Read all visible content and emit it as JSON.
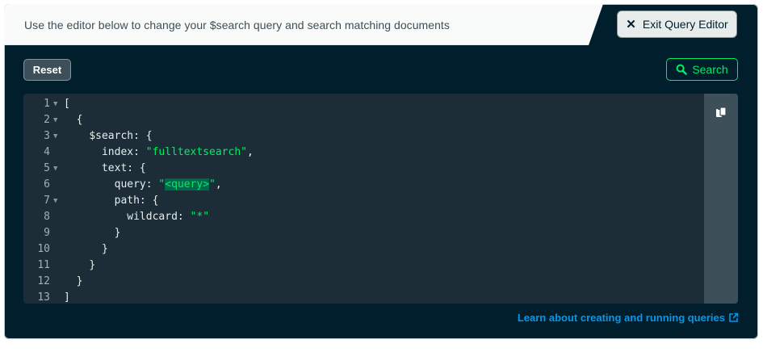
{
  "header": {
    "description": "Use the editor below to change your $search query and search matching documents",
    "exit_button_label": "Exit Query Editor"
  },
  "toolbar": {
    "reset_label": "Reset",
    "search_label": "Search"
  },
  "editor": {
    "lines": [
      {
        "n": "1",
        "fold": true,
        "indent": "",
        "parts": [
          {
            "t": "[",
            "c": "p"
          }
        ]
      },
      {
        "n": "2",
        "fold": true,
        "indent": "  ",
        "parts": [
          {
            "t": "{",
            "c": "p"
          }
        ]
      },
      {
        "n": "3",
        "fold": true,
        "indent": "    ",
        "parts": [
          {
            "t": "$search: {",
            "c": "p"
          }
        ]
      },
      {
        "n": "4",
        "fold": false,
        "indent": "      ",
        "parts": [
          {
            "t": "index: ",
            "c": "p"
          },
          {
            "t": "\"fulltextsearch\"",
            "c": "s"
          },
          {
            "t": ",",
            "c": "p"
          }
        ]
      },
      {
        "n": "5",
        "fold": true,
        "indent": "      ",
        "parts": [
          {
            "t": "text: {",
            "c": "p"
          }
        ]
      },
      {
        "n": "6",
        "fold": false,
        "indent": "        ",
        "parts": [
          {
            "t": "query: ",
            "c": "p"
          },
          {
            "t": "\"",
            "c": "s"
          },
          {
            "t": "<query>",
            "c": "h"
          },
          {
            "t": "\"",
            "c": "s"
          },
          {
            "t": ",",
            "c": "p"
          }
        ]
      },
      {
        "n": "7",
        "fold": true,
        "indent": "        ",
        "parts": [
          {
            "t": "path: {",
            "c": "p"
          }
        ]
      },
      {
        "n": "8",
        "fold": false,
        "indent": "          ",
        "parts": [
          {
            "t": "wildcard: ",
            "c": "p"
          },
          {
            "t": "\"*\"",
            "c": "s"
          }
        ]
      },
      {
        "n": "9",
        "fold": false,
        "indent": "        ",
        "parts": [
          {
            "t": "}",
            "c": "p"
          }
        ]
      },
      {
        "n": "10",
        "fold": false,
        "indent": "      ",
        "parts": [
          {
            "t": "}",
            "c": "p"
          }
        ]
      },
      {
        "n": "11",
        "fold": false,
        "indent": "    ",
        "parts": [
          {
            "t": "}",
            "c": "p"
          }
        ]
      },
      {
        "n": "12",
        "fold": false,
        "indent": "  ",
        "parts": [
          {
            "t": "}",
            "c": "p"
          }
        ]
      },
      {
        "n": "13",
        "fold": false,
        "indent": "",
        "parts": [
          {
            "t": "]",
            "c": "p"
          }
        ]
      }
    ]
  },
  "footer": {
    "learn_link_label": "Learn about creating and running queries"
  },
  "icons": {
    "exit": "close-icon",
    "search": "magnifier-icon",
    "copy": "copy-icon",
    "external": "external-link-icon"
  },
  "colors": {
    "panel_bg": "#001e2b",
    "editor_bg": "#1c2d38",
    "accent_green": "#00ed64",
    "link_blue": "#0498ec",
    "highlight_bg": "#00684a"
  }
}
